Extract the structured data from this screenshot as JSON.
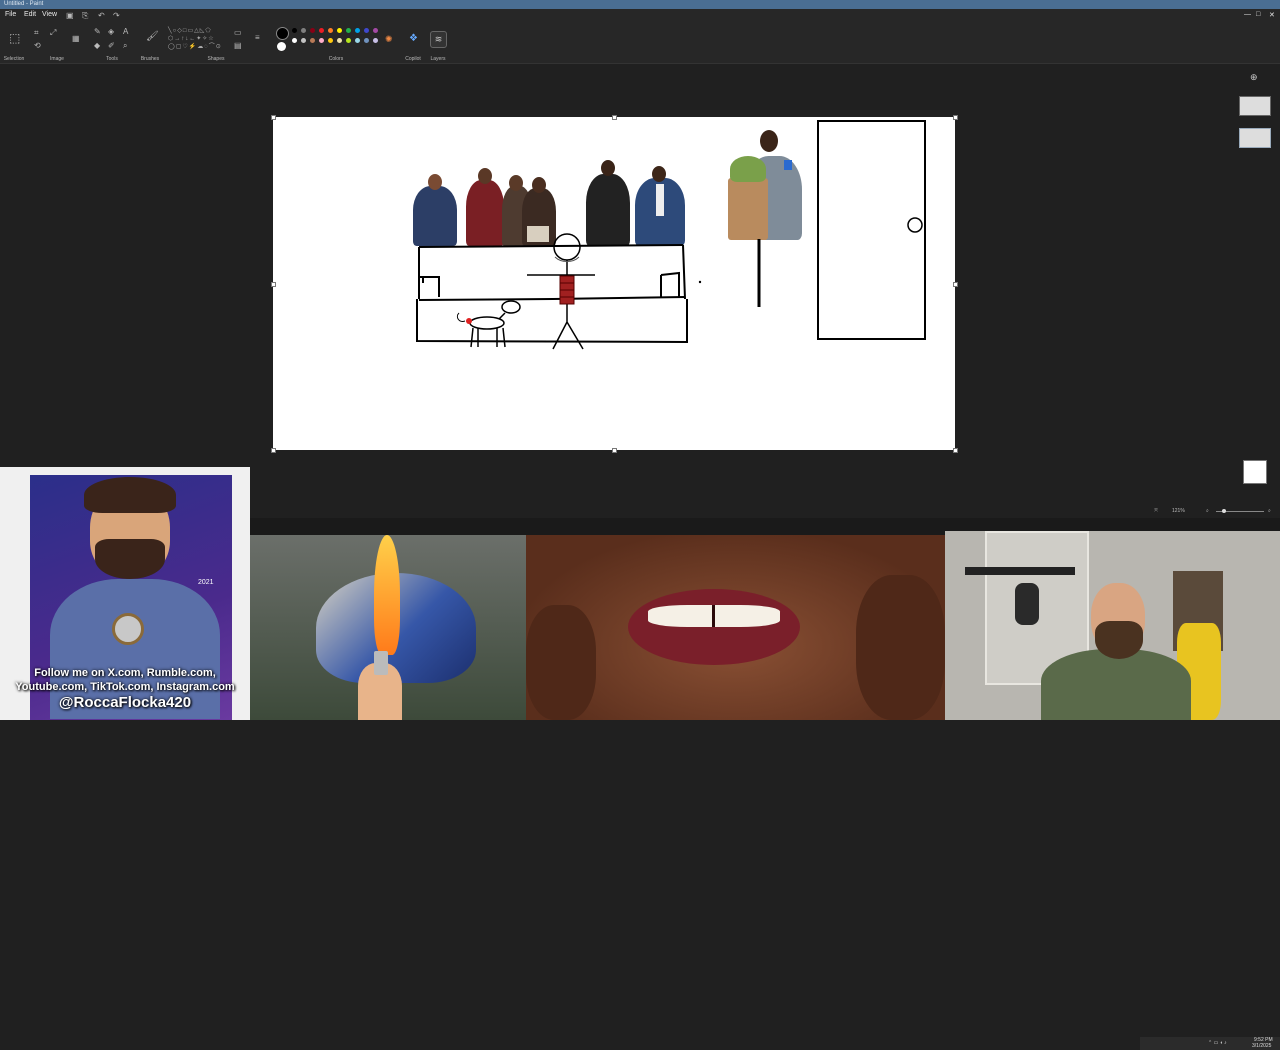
{
  "window": {
    "title": "Untitled - Paint",
    "controls": [
      "—",
      "□",
      "✕"
    ]
  },
  "menu": {
    "file": "File",
    "edit": "Edit",
    "view": "View"
  },
  "toolbar": {
    "groups": {
      "selection": "Selection",
      "image": "Image",
      "tools": "Tools",
      "brushes": "Brushes",
      "shapes": "Shapes",
      "colors": "Colors",
      "copilot": "Copilot",
      "layers": "Layers"
    },
    "palette": [
      "#000000",
      "#7f7f7f",
      "#880015",
      "#ed1c24",
      "#ff7f27",
      "#fff200",
      "#22b14c",
      "#00a2e8",
      "#3f48cc",
      "#a349a4",
      "#ffffff",
      "#c3c3c3",
      "#b97a57",
      "#ffaec9",
      "#ffc90e",
      "#efe4b0",
      "#b5e61d",
      "#99d9ea",
      "#7092be",
      "#c8bfe7"
    ]
  },
  "status": {
    "zoom": "121%",
    "time": "9:52 PM",
    "date": "3/1/2025"
  },
  "overlay": {
    "line1": "Follow me on X.com, Rumble.com,",
    "line2": "Youtube.com, TikTok.com, Instagram.com",
    "handle": "@RoccaFlocka420",
    "sig": "2021"
  },
  "colors": {
    "accent": "#4a6e93",
    "bg": "#202020",
    "canvas": "#ffffff"
  }
}
